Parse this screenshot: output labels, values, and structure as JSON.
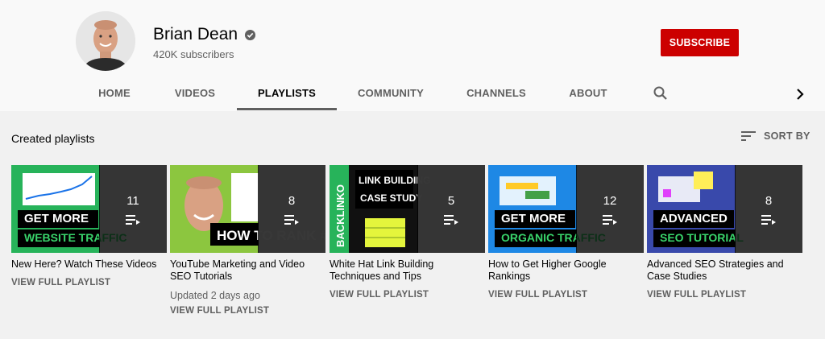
{
  "channel": {
    "name": "Brian Dean",
    "subscribers": "420K subscribers",
    "subscribe_label": "SUBSCRIBE",
    "verified_icon": "verified-check-icon"
  },
  "tabs": [
    {
      "label": "HOME",
      "active": false
    },
    {
      "label": "VIDEOS",
      "active": false
    },
    {
      "label": "PLAYLISTS",
      "active": true
    },
    {
      "label": "COMMUNITY",
      "active": false
    },
    {
      "label": "CHANNELS",
      "active": false
    },
    {
      "label": "ABOUT",
      "active": false
    }
  ],
  "section": {
    "title": "Created playlists",
    "sort_label": "SORT BY"
  },
  "playlists": [
    {
      "title": "New Here? Watch These Videos",
      "count": "11",
      "thumb_text": [
        "GET MORE",
        "WEBSITE TRAFFIC"
      ],
      "link": "VIEW FULL PLAYLIST"
    },
    {
      "title": "YouTube Marketing and Video SEO Tutorials",
      "count": "8",
      "thumb_text": [
        "HOW TO RANK #1"
      ],
      "updated": "Updated 2 days ago",
      "link": "VIEW FULL PLAYLIST"
    },
    {
      "title": "White Hat Link Building Techniques and Tips",
      "count": "5",
      "thumb_text": [
        "LINK BUILDING",
        "CASE STUDY",
        "BACKLINKO"
      ],
      "link": "VIEW FULL PLAYLIST"
    },
    {
      "title": "How to Get Higher Google Rankings",
      "count": "12",
      "thumb_text": [
        "GET MORE",
        "ORGANIC TRAFFIC"
      ],
      "link": "VIEW FULL PLAYLIST"
    },
    {
      "title": "Advanced SEO Strategies and Case Studies",
      "count": "8",
      "thumb_text": [
        "ADVANCED",
        "SEO TUTORIAL"
      ],
      "link": "VIEW FULL PLAYLIST"
    }
  ],
  "colors": {
    "subscribe": "#cc0000",
    "accent_green": "#2ecc71",
    "background": "#f9f9f9",
    "content_bg": "#f1f1f1"
  }
}
